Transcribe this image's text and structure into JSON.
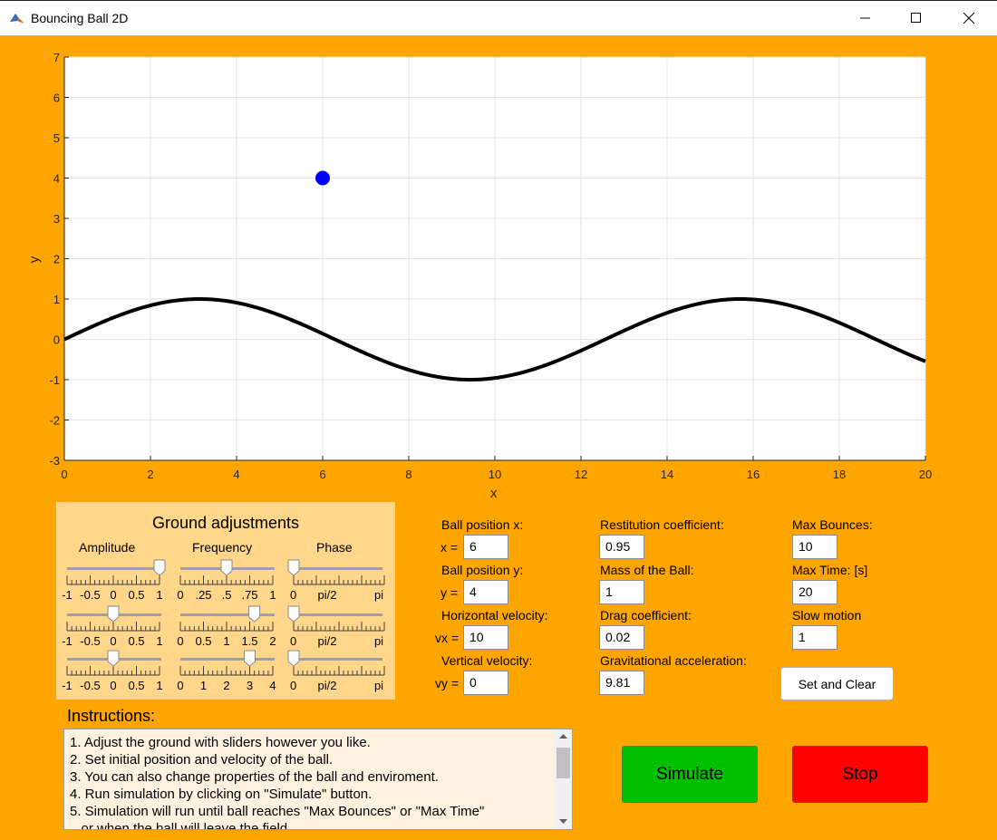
{
  "window": {
    "title": "Bouncing Ball 2D"
  },
  "chart_data": {
    "type": "line",
    "xlabel": "x",
    "ylabel": "y",
    "xlim": [
      0,
      20
    ],
    "ylim": [
      -3,
      7
    ],
    "xticks": [
      0,
      2,
      4,
      6,
      8,
      10,
      12,
      14,
      16,
      18,
      20
    ],
    "yticks": [
      -3,
      -2,
      -1,
      0,
      1,
      2,
      3,
      4,
      5,
      6,
      7
    ],
    "grid": true,
    "series": [
      {
        "kind": "ground",
        "function": "y = 1*sin(0.5*x)",
        "color": "#000000"
      }
    ],
    "ball": {
      "x": 6,
      "y": 4,
      "color": "#0000ff"
    }
  },
  "ground_panel": {
    "title": "Ground adjustments",
    "headers": [
      "Amplitude",
      "Frequency",
      "Phase"
    ],
    "sliders": [
      {
        "name": "amplitude-1",
        "ticks": [
          "-1",
          "-0.5",
          "0",
          "0.5",
          "1"
        ],
        "value": 1,
        "fraction": 1.0
      },
      {
        "name": "frequency-1",
        "ticks": [
          "0",
          ".25",
          ".5",
          ".75",
          "1"
        ],
        "value": 0.5,
        "fraction": 0.5
      },
      {
        "name": "phase-1",
        "ticks": [
          "0",
          "pi/2",
          "pi"
        ],
        "value": 0,
        "fraction": 0.0
      },
      {
        "name": "amplitude-2",
        "ticks": [
          "-1",
          "-0.5",
          "0",
          "0.5",
          "1"
        ],
        "value": 0,
        "fraction": 0.5
      },
      {
        "name": "frequency-2",
        "ticks": [
          "0",
          "0.5",
          "1",
          "1.5",
          "2"
        ],
        "value": 1.6,
        "fraction": 0.8
      },
      {
        "name": "phase-2",
        "ticks": [
          "0",
          "pi/2",
          "pi"
        ],
        "value": 0,
        "fraction": 0.0
      },
      {
        "name": "amplitude-3",
        "ticks": [
          "-1",
          "-0.5",
          "0",
          "0.5",
          "1"
        ],
        "value": 0,
        "fraction": 0.5
      },
      {
        "name": "frequency-3",
        "ticks": [
          "0",
          "1",
          "2",
          "3",
          "4"
        ],
        "value": 3,
        "fraction": 0.75
      },
      {
        "name": "phase-3",
        "ticks": [
          "0",
          "pi/2",
          "pi"
        ],
        "value": 0,
        "fraction": 0.0
      }
    ]
  },
  "fields": {
    "ball_x": {
      "label": "Ball position x:",
      "prefix": "x =",
      "value": "6"
    },
    "ball_y": {
      "label": "Ball position y:",
      "prefix": "y =",
      "value": "4"
    },
    "vx": {
      "label": "Horizontal velocity:",
      "prefix": "vx =",
      "value": "10"
    },
    "vy": {
      "label": "Vertical velocity:",
      "prefix": "vy =",
      "value": "0"
    },
    "restitution": {
      "label": "Restitution coefficient:",
      "value": "0.95"
    },
    "mass": {
      "label": "Mass of the Ball:",
      "value": "1"
    },
    "drag": {
      "label": "Drag coefficient:",
      "value": "0.02"
    },
    "gravity": {
      "label": "Gravitational acceleration:",
      "value": "9.81"
    },
    "max_bounces": {
      "label": "Max Bounces:",
      "value": "10"
    },
    "max_time": {
      "label": "Max Time: [s]",
      "value": "20"
    },
    "slow_motion": {
      "label": "Slow motion",
      "value": "1"
    }
  },
  "buttons": {
    "set_clear": "Set and Clear",
    "simulate": "Simulate",
    "stop": "Stop"
  },
  "colors": {
    "background": "#ffa500",
    "panel": "#ffd68a",
    "simulate": "#00c000",
    "stop": "#ff0000"
  },
  "instructions": {
    "title": "Instructions:",
    "lines": [
      "1. Adjust the ground with sliders however you like.",
      "2. Set initial position and velocity of the ball.",
      "3. You can also change properties of the ball and enviroment.",
      "4. Run simulation by clicking on \"Simulate\" button.",
      "5. Simulation will run until ball reaches \"Max Bounces\" or \"Max Time\"",
      "   or when the ball will leave the field."
    ]
  }
}
